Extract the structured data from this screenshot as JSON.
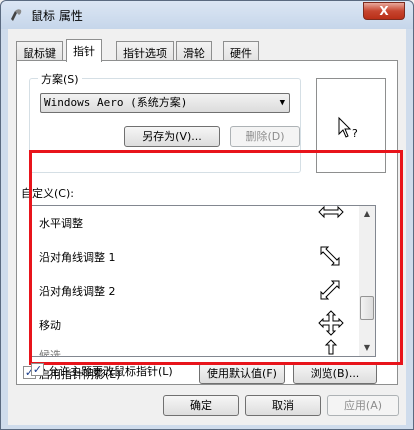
{
  "window": {
    "title": "鼠标 属性",
    "close_glyph": "X"
  },
  "tabs": [
    {
      "label": "鼠标键",
      "active": false
    },
    {
      "label": "指针",
      "active": true
    },
    {
      "label": "指针选项",
      "active": false
    },
    {
      "label": "滑轮",
      "active": false
    },
    {
      "label": "硬件",
      "active": false
    }
  ],
  "scheme": {
    "label": "方案(S)",
    "selected": "Windows Aero (系统方案)",
    "save_as": "另存为(V)...",
    "delete": "删除(D)"
  },
  "customize": {
    "label": "自定义(C):",
    "items": [
      {
        "label": "水平调整",
        "icon": "horizontal-resize-cursor-icon"
      },
      {
        "label": "沿对角线调整 1",
        "icon": "diagonal-resize-1-cursor-icon"
      },
      {
        "label": "沿对角线调整 2",
        "icon": "diagonal-resize-2-cursor-icon"
      },
      {
        "label": "移动",
        "icon": "move-cursor-icon"
      },
      {
        "label": "候选",
        "icon": "alternate-select-cursor-icon"
      }
    ]
  },
  "shadow": {
    "label": "启用指针阴影(E)",
    "checked": true
  },
  "buttons": {
    "use_default": "使用默认值(F)",
    "browse": "浏览(B)..."
  },
  "allow_themes": {
    "label": "允许主题更改鼠标指针(L)",
    "checked": true
  },
  "dialog": {
    "ok": "确定",
    "cancel": "取消",
    "apply": "应用(A)"
  },
  "colors": {
    "highlight": "#e8141b",
    "title_bar": "#cfdcec",
    "close_button": "#c7452f"
  }
}
